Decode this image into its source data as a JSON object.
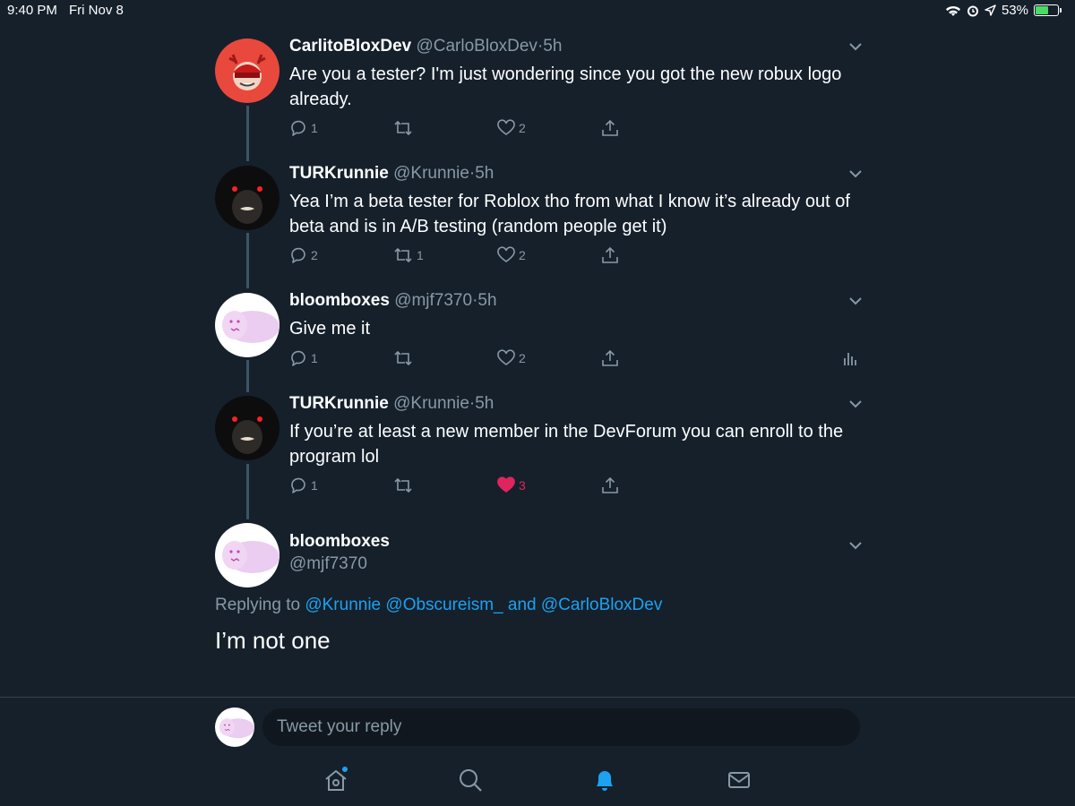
{
  "status_bar": {
    "time": "9:40 PM",
    "date": "Fri Nov 8",
    "battery": "53%"
  },
  "colors": {
    "background": "#15202b",
    "accent": "#1da1f2",
    "muted": "#8899a6",
    "like": "#e0245e"
  },
  "tweets": [
    {
      "name": "CarlitoBloxDev",
      "handle": "@CarloBloxDev",
      "dot": "·",
      "age": "5h",
      "text": "Are you a tester? I'm just wondering since you got the new robux logo already.",
      "replies": "1",
      "retweets": "",
      "likes": "2",
      "liked": false
    },
    {
      "name": "TURKrunnie",
      "handle": "@Krunnie",
      "dot": "·",
      "age": "5h",
      "text": "Yea I’m a beta tester for Roblox tho from what I know it’s already out of beta and is in A/B testing (random people get it)",
      "replies": "2",
      "retweets": "1",
      "likes": "2",
      "liked": false
    },
    {
      "name": "bloomboxes",
      "handle": "@mjf7370",
      "dot": "·",
      "age": "5h",
      "text": "Give me it",
      "replies": "1",
      "retweets": "",
      "likes": "2",
      "liked": false
    },
    {
      "name": "TURKrunnie",
      "handle": "@Krunnie",
      "dot": "·",
      "age": "5h",
      "text": "If you’re at least a new member in the DevForum you can enroll to the program lol",
      "replies": "1",
      "retweets": "",
      "likes": "3",
      "liked": true
    }
  ],
  "focused_tweet": {
    "name": "bloomboxes",
    "handle": "@mjf7370",
    "replying_prefix": "Replying to",
    "replying_to_1": "@Krunnie",
    "replying_to_2": "@Obscureism_",
    "replying_and": "and",
    "replying_to_3": "@CarloBloxDev",
    "text": "I’m not one"
  },
  "reply_bar": {
    "placeholder": "Tweet your reply"
  },
  "tab_bar": {
    "items": [
      "home-icon",
      "search-icon",
      "notifications-icon",
      "messages-icon"
    ],
    "active": "notifications-icon"
  }
}
